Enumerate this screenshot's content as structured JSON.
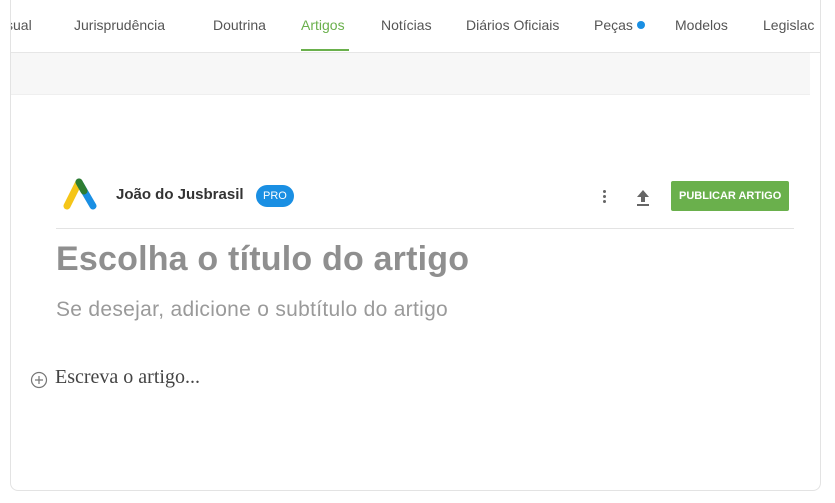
{
  "nav": {
    "items": [
      {
        "label": "ssual"
      },
      {
        "label": "Jurisprudência"
      },
      {
        "label": "Doutrina"
      },
      {
        "label": "Artigos",
        "active": true
      },
      {
        "label": "Notícias"
      },
      {
        "label": "Diários Oficiais"
      },
      {
        "label": "Peças",
        "has_dot": true
      },
      {
        "label": "Modelos"
      },
      {
        "label": "Legislac"
      }
    ],
    "active_color": "#6ab04c",
    "dot_color": "#1a8fe3"
  },
  "editor": {
    "author": {
      "name": "João do Jusbrasil",
      "badge": "PRO",
      "logo_icon": "jusbrasil-logo"
    },
    "actions": {
      "more_icon": "kebab-menu-icon",
      "upload_icon": "upload-icon",
      "publish_label": "PUBLICAR ARTIGO"
    },
    "title_placeholder": "Escolha o título do artigo",
    "subtitle_placeholder": "Se desejar, adicione o subtítulo do artigo",
    "body_placeholder": "Escreva o artigo...",
    "add_block_icon": "plus-circle-icon"
  }
}
